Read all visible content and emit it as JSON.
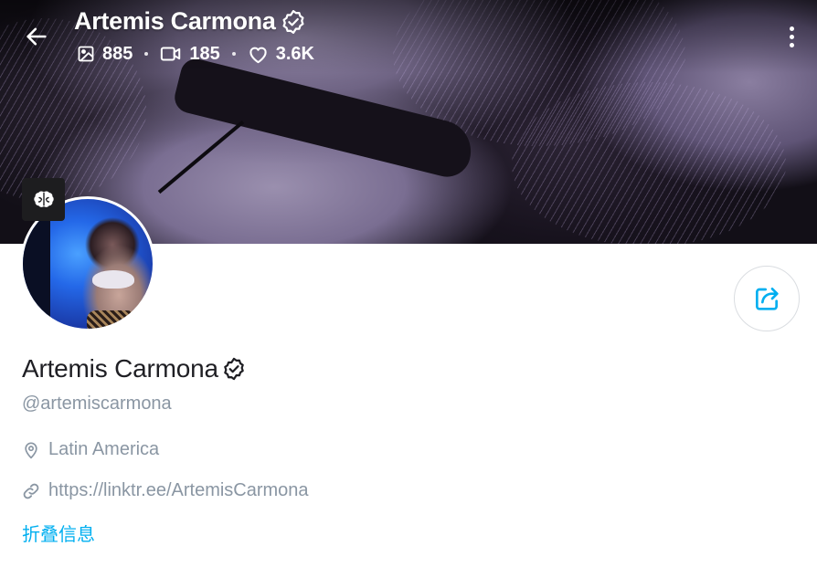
{
  "header": {
    "name": "Artemis Carmona",
    "stats": {
      "photos": "885",
      "videos": "185",
      "likes": "3.6K"
    }
  },
  "profile": {
    "name": "Artemis Carmona",
    "handle": "@artemiscarmona",
    "location": "Latin America",
    "link": "https://linktr.ee/ArtemisCarmona",
    "collapse_label": "折叠信息"
  },
  "icons": {
    "back": "arrow-left-icon",
    "verified": "verified-badge-icon",
    "photo": "image-icon",
    "video": "video-camera-icon",
    "likes": "heart-icon",
    "more": "more-vertical-icon",
    "badge": "brain-icon",
    "share": "share-icon",
    "location": "location-pin-icon",
    "link": "link-icon"
  },
  "colors": {
    "accent": "#00aff0",
    "text_primary": "#1f1f24",
    "text_secondary": "#8a96a3",
    "border": "#dadde1"
  }
}
